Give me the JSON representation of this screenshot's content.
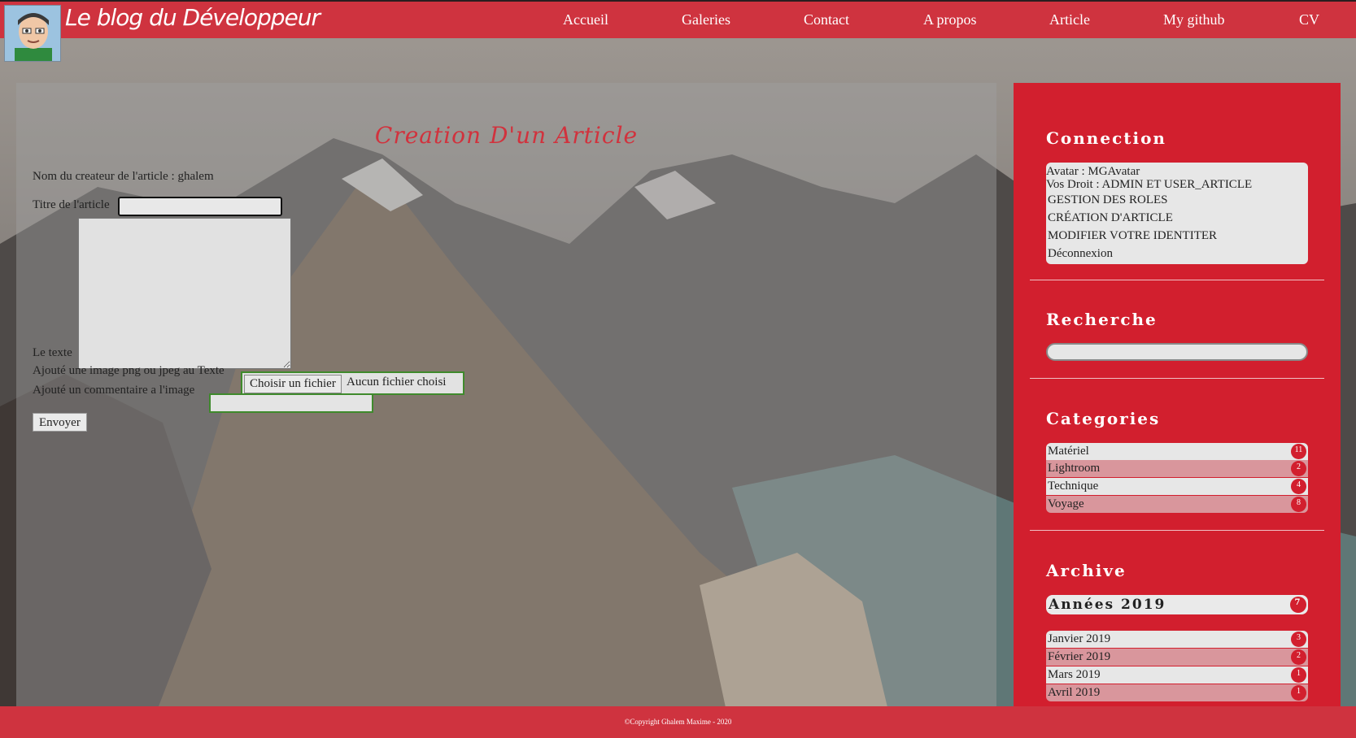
{
  "header": {
    "brand": "Le blog du Développeur",
    "nav": [
      {
        "label": "Accueil"
      },
      {
        "label": "Galeries"
      },
      {
        "label": "Contact"
      },
      {
        "label": "A propos"
      },
      {
        "label": "Article"
      },
      {
        "label": "My github"
      },
      {
        "label": "CV"
      }
    ]
  },
  "form": {
    "heading": "Creation D'un Article",
    "creator_label": "Nom du createur de l'article : ghalem",
    "title_label": "Titre de l'article",
    "title_value": "",
    "text_label": "Le texte",
    "text_value": "",
    "image_label": "Ajouté une image png ou jpeg au Texte",
    "file_button": "Choisir un fichier",
    "file_status": "Aucun fichier choisi",
    "comment_label": "Ajouté un commentaire a l'image",
    "comment_value": "",
    "submit": "Envoyer"
  },
  "sidebar": {
    "connection": {
      "title": "Connection",
      "avatar": "Avatar : MGAvatar",
      "rights": "Vos Droit : ADMIN ET USER_ARTICLE",
      "links": [
        {
          "label": "GESTION DES ROLES"
        },
        {
          "label": "CRÉATION D'ARTICLE"
        },
        {
          "label": "MODIFIER VOTRE IDENTITER"
        },
        {
          "label": "Déconnexion"
        }
      ]
    },
    "search": {
      "title": "Recherche",
      "value": ""
    },
    "categories": {
      "title": "Categories",
      "items": [
        {
          "label": "Matériel",
          "count": "11"
        },
        {
          "label": "Lightroom",
          "count": "2"
        },
        {
          "label": "Technique",
          "count": "4"
        },
        {
          "label": "Voyage",
          "count": "8"
        }
      ]
    },
    "archive": {
      "title": "Archive",
      "year_label": "Années 2019",
      "year_count": "7",
      "months": [
        {
          "label": "Janvier 2019",
          "count": "3"
        },
        {
          "label": "Février 2019",
          "count": "2"
        },
        {
          "label": "Mars 2019",
          "count": "1"
        },
        {
          "label": "Avril 2019",
          "count": "1"
        }
      ]
    }
  },
  "footer": {
    "copyright": "©Copyright Ghalem Maxime - 2020"
  },
  "colors": {
    "brand_red": "#cf333f",
    "sidebar_red": "#d21f2e",
    "heading_red": "#d1323d",
    "valid_green": "#3f8a2c"
  }
}
